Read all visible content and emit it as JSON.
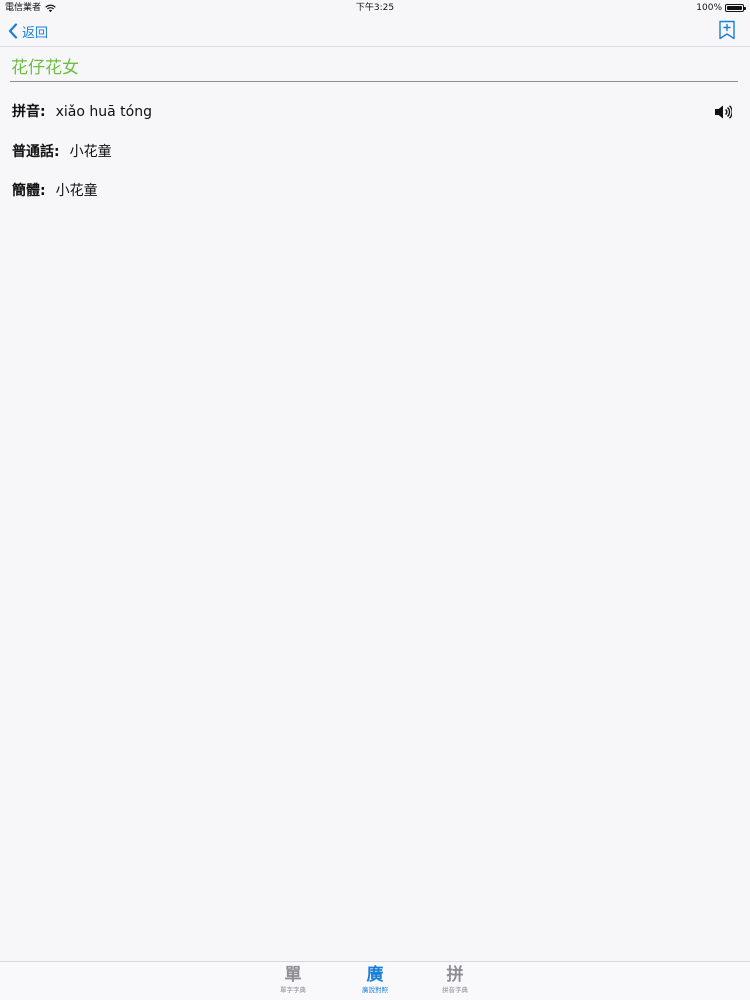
{
  "status_bar": {
    "carrier": "電信業者",
    "time": "下午3:25",
    "battery": "100%",
    "battery_level": 1.0
  },
  "nav": {
    "back_label": "返回",
    "back_icon": "chevron-left-icon",
    "bookmark_icon": "bookmark-add-icon"
  },
  "term": {
    "title": "花仔花女"
  },
  "fields": [
    {
      "label": "拼音",
      "sep": ":",
      "value": "xiǎo huā tóng"
    },
    {
      "label": "普通話",
      "sep": ":",
      "value": "小花童"
    },
    {
      "label": "簡體",
      "sep": ":",
      "value": "小花童"
    }
  ],
  "speaker_icon": "speaker-icon",
  "tabs": [
    {
      "glyph": "單",
      "label": "單字字典",
      "active": false
    },
    {
      "glyph": "廣",
      "label": "廣說對照",
      "active": true
    },
    {
      "glyph": "拼",
      "label": "拼音字典",
      "active": false
    }
  ],
  "colors": {
    "accent": "#1a7fd8",
    "title_green": "#6cbf3f",
    "inactive_tab": "#8e8e93",
    "background": "#f7f7fa"
  }
}
